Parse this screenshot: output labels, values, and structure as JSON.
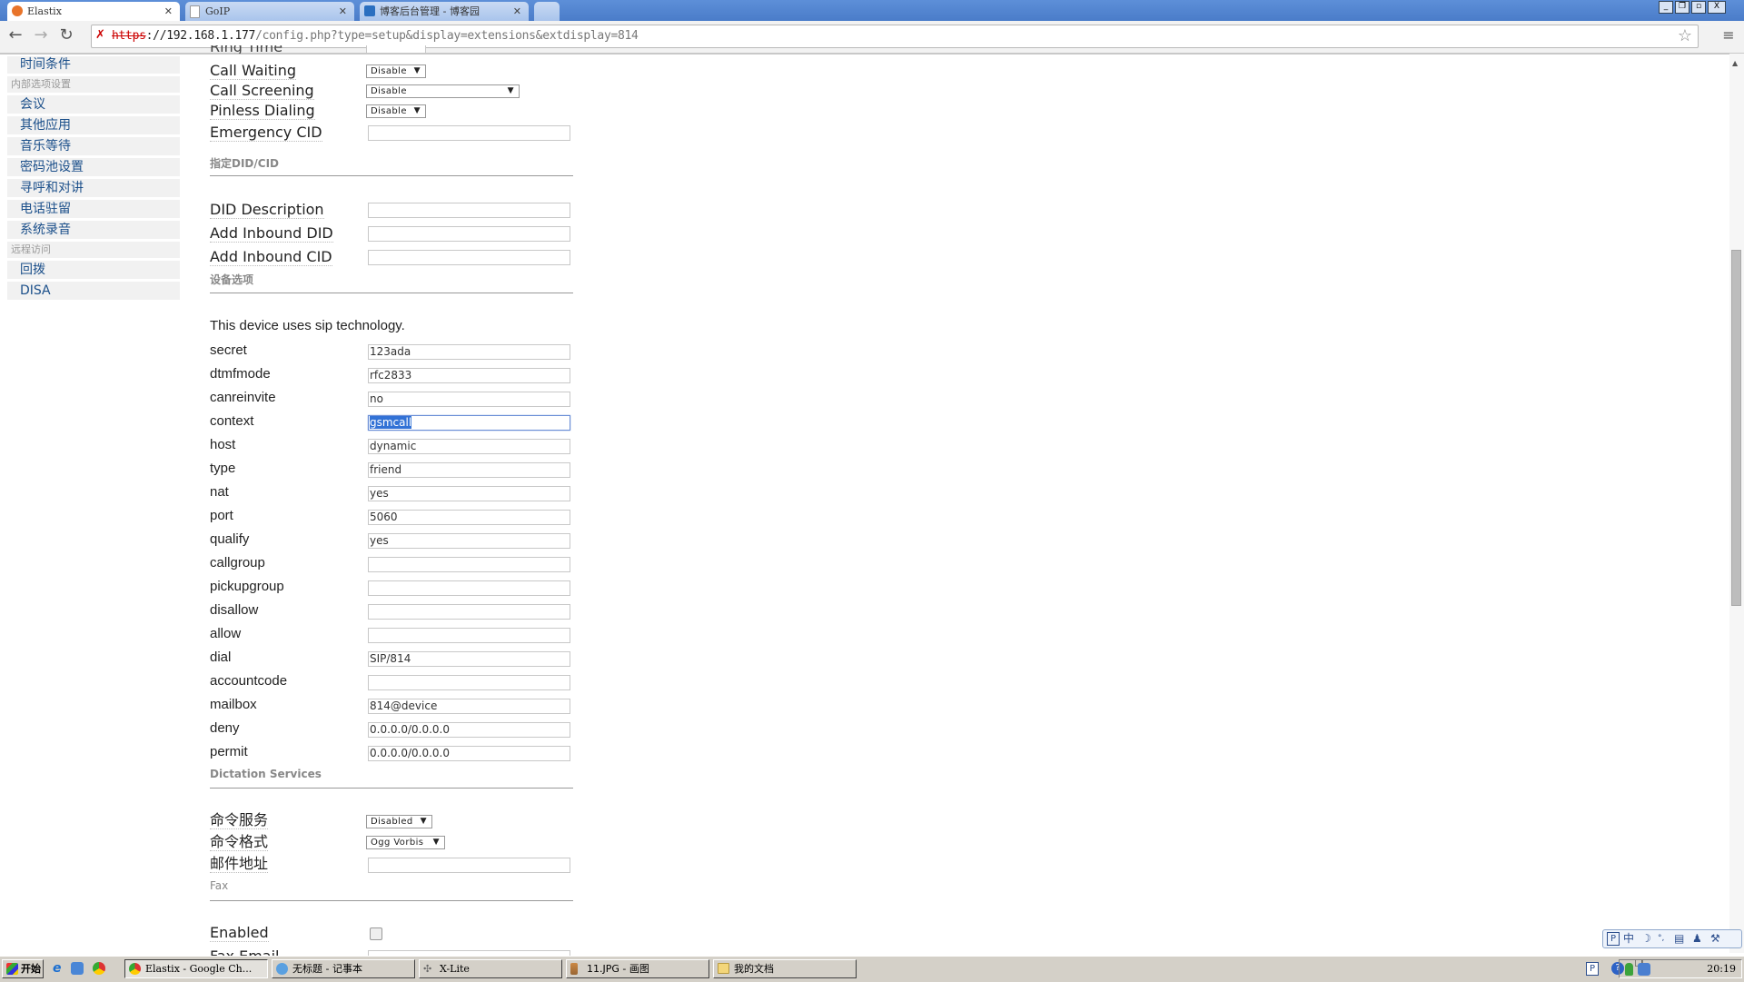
{
  "browser": {
    "tabs": [
      {
        "label": "Elastix",
        "active": true
      },
      {
        "label": "GoIP",
        "active": false
      },
      {
        "label": "博客后台管理 - 博客园",
        "active": false
      }
    ],
    "url": {
      "scheme": "https",
      "host": "://192.168.1.177",
      "path": "/config.php?type=setup&display=extensions&extdisplay=814"
    }
  },
  "sidebar": {
    "items": [
      {
        "label": "时间条件",
        "type": "item"
      },
      {
        "label": "内部选项设置",
        "type": "category"
      },
      {
        "label": "会议",
        "type": "item"
      },
      {
        "label": "其他应用",
        "type": "item"
      },
      {
        "label": "音乐等待",
        "type": "item"
      },
      {
        "label": "密码池设置",
        "type": "item"
      },
      {
        "label": "寻呼和对讲",
        "type": "item"
      },
      {
        "label": "电话驻留",
        "type": "item"
      },
      {
        "label": "系统录音",
        "type": "item"
      },
      {
        "label": "远程访问",
        "type": "category"
      },
      {
        "label": "回拨",
        "type": "item"
      },
      {
        "label": "DISA",
        "type": "item"
      }
    ]
  },
  "form": {
    "partial_top_label": "Ring Time",
    "general": [
      {
        "label": "Call Waiting",
        "kind": "select",
        "value": "Disable"
      },
      {
        "label": "Call Screening",
        "kind": "select",
        "value": "Disable"
      },
      {
        "label": "Pinless Dialing",
        "kind": "select",
        "value": "Disable"
      },
      {
        "label": "Emergency CID",
        "kind": "text",
        "value": ""
      }
    ],
    "did_section": {
      "title": "指定DID/CID",
      "fields": [
        {
          "label": "DID Description",
          "value": ""
        },
        {
          "label": "Add Inbound DID",
          "value": ""
        },
        {
          "label": "Add Inbound CID",
          "value": ""
        }
      ]
    },
    "device_section": {
      "title": "设备选项",
      "note": "This device uses sip technology.",
      "fields": [
        {
          "label": "secret",
          "value": "123ada"
        },
        {
          "label": "dtmfmode",
          "value": "rfc2833"
        },
        {
          "label": "canreinvite",
          "value": "no"
        },
        {
          "label": "context",
          "value": "gsmcall",
          "selected": true
        },
        {
          "label": "host",
          "value": "dynamic"
        },
        {
          "label": "type",
          "value": "friend"
        },
        {
          "label": "nat",
          "value": "yes"
        },
        {
          "label": "port",
          "value": "5060"
        },
        {
          "label": "qualify",
          "value": "yes"
        },
        {
          "label": "callgroup",
          "value": ""
        },
        {
          "label": "pickupgroup",
          "value": ""
        },
        {
          "label": "disallow",
          "value": ""
        },
        {
          "label": "allow",
          "value": ""
        },
        {
          "label": "dial",
          "value": "SIP/814"
        },
        {
          "label": "accountcode",
          "value": ""
        },
        {
          "label": "mailbox",
          "value": "814@device"
        },
        {
          "label": "deny",
          "value": "0.0.0.0/0.0.0.0"
        },
        {
          "label": "permit",
          "value": "0.0.0.0/0.0.0.0"
        }
      ]
    },
    "dictation_section": {
      "title": "Dictation Services",
      "fields": [
        {
          "label": "命令服务",
          "kind": "select",
          "value": "Disabled"
        },
        {
          "label": "命令格式",
          "kind": "select",
          "value": "Ogg Vorbis"
        },
        {
          "label": "邮件地址",
          "kind": "text",
          "value": ""
        }
      ]
    },
    "fax_section": {
      "title": "Fax",
      "fields": [
        {
          "label": "Enabled",
          "kind": "checkbox",
          "checked": false
        },
        {
          "label": "Fax Email",
          "kind": "text",
          "value": ""
        }
      ]
    }
  },
  "ime_bar": {
    "mode_label": "中"
  },
  "taskbar": {
    "start_label": "开始",
    "tasks": [
      {
        "label": "Elastix - Google Ch...",
        "active": true
      },
      {
        "label": "无标题 - 记事本",
        "active": false
      },
      {
        "label": "X-Lite",
        "active": false
      },
      {
        "label": "11.JPG - 画图",
        "active": false
      },
      {
        "label": "我的文档",
        "active": false
      }
    ],
    "clock": "20:19"
  }
}
